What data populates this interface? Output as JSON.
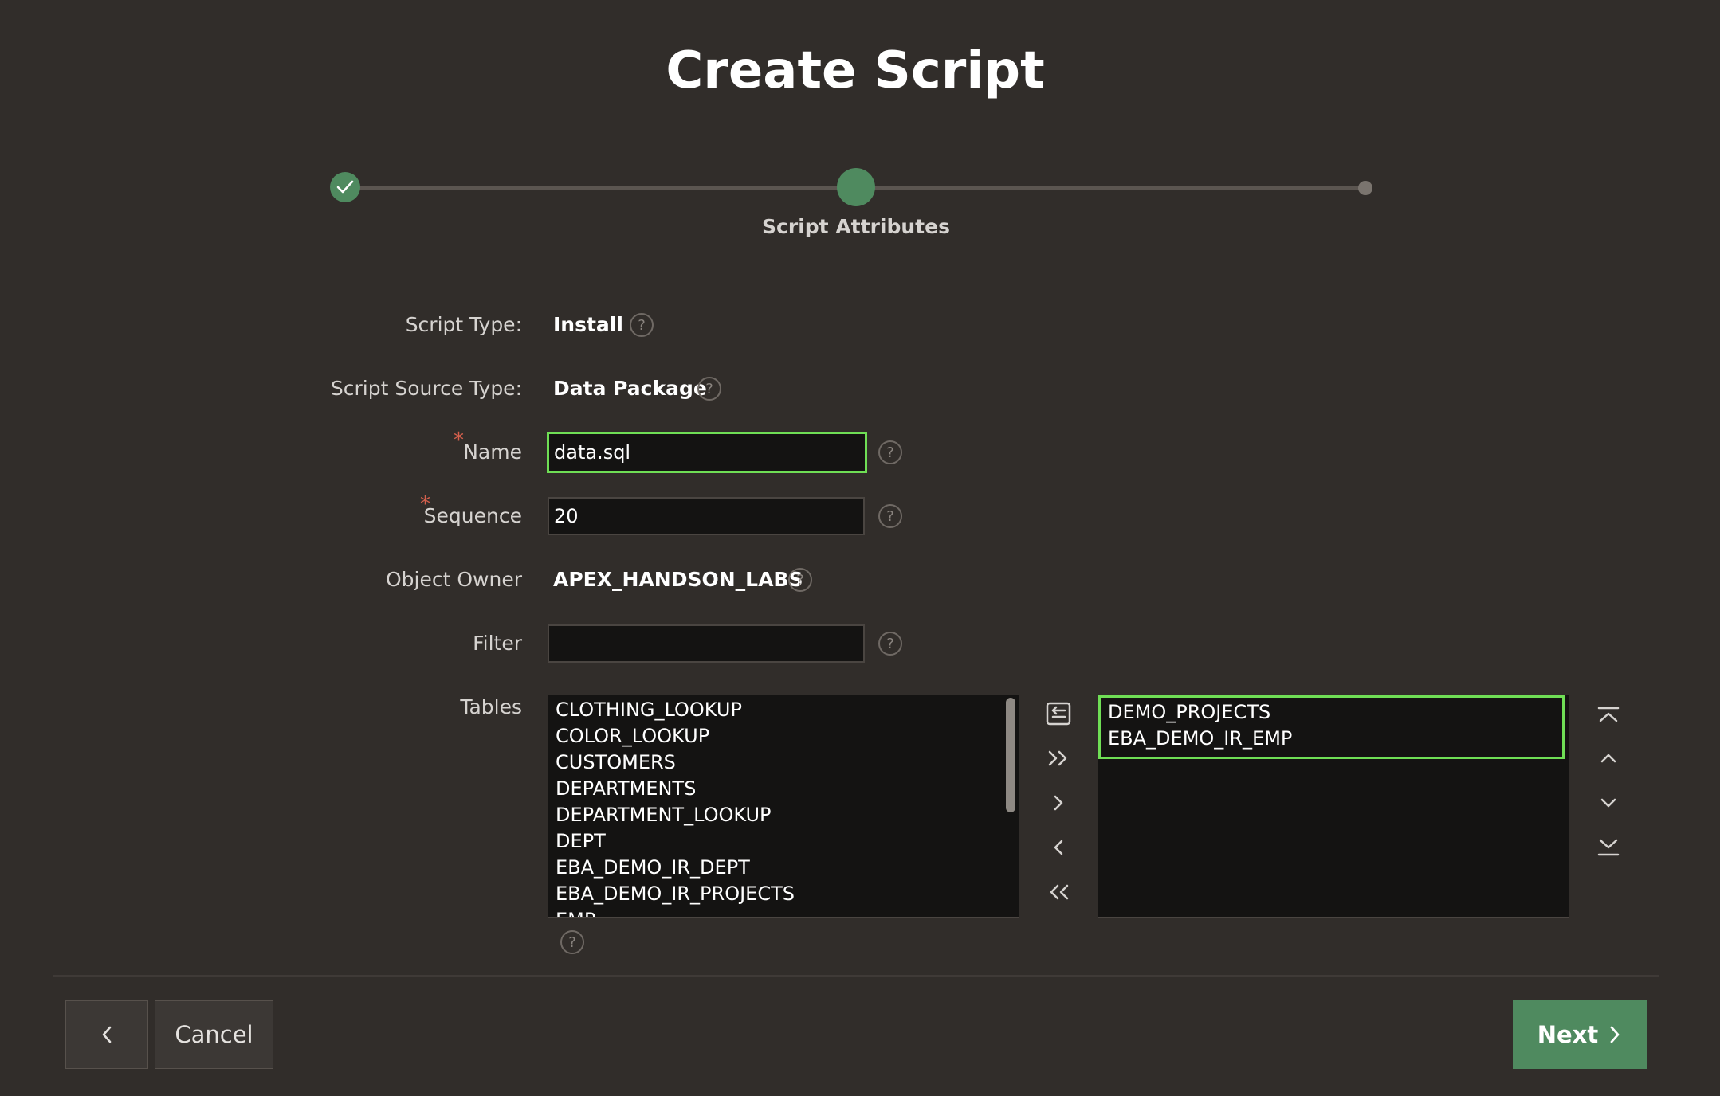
{
  "page": {
    "title": "Create Script"
  },
  "wizard": {
    "current_step_label": "Script Attributes"
  },
  "form": {
    "script_type": {
      "label": "Script Type:",
      "value": "Install"
    },
    "script_source_type": {
      "label": "Script Source Type:",
      "value": "Data Package"
    },
    "name": {
      "label": "Name",
      "required_mark": "*",
      "value": "data.sql"
    },
    "sequence": {
      "label": "Sequence",
      "required_mark": "*",
      "value": "20"
    },
    "object_owner": {
      "label": "Object Owner",
      "value": "APEX_HANDSON_LABS"
    },
    "filter": {
      "label": "Filter",
      "value": ""
    },
    "tables": {
      "label": "Tables",
      "available": [
        "CLOTHING_LOOKUP",
        "COLOR_LOOKUP",
        "CUSTOMERS",
        "DEPARTMENTS",
        "DEPARTMENT_LOOKUP",
        "DEPT",
        "EBA_DEMO_IR_DEPT",
        "EBA_DEMO_IR_PROJECTS",
        "EMP"
      ],
      "selected": [
        "DEMO_PROJECTS",
        "EBA_DEMO_IR_EMP"
      ]
    }
  },
  "help_icon_glyph": "?",
  "buttons": {
    "cancel": "Cancel",
    "next": "Next"
  },
  "colors": {
    "accent_green": "#4f8a5f",
    "focus_ring": "#6fde55",
    "background": "#312d2a"
  }
}
